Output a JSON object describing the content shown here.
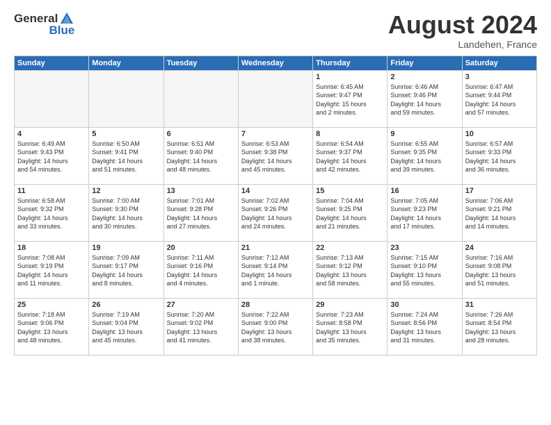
{
  "header": {
    "logo_general": "General",
    "logo_blue": "Blue",
    "month_year": "August 2024",
    "location": "Landehen, France"
  },
  "weekdays": [
    "Sunday",
    "Monday",
    "Tuesday",
    "Wednesday",
    "Thursday",
    "Friday",
    "Saturday"
  ],
  "weeks": [
    [
      {
        "day": "",
        "info": ""
      },
      {
        "day": "",
        "info": ""
      },
      {
        "day": "",
        "info": ""
      },
      {
        "day": "",
        "info": ""
      },
      {
        "day": "1",
        "info": "Sunrise: 6:45 AM\nSunset: 9:47 PM\nDaylight: 15 hours\nand 2 minutes."
      },
      {
        "day": "2",
        "info": "Sunrise: 6:46 AM\nSunset: 9:46 PM\nDaylight: 14 hours\nand 59 minutes."
      },
      {
        "day": "3",
        "info": "Sunrise: 6:47 AM\nSunset: 9:44 PM\nDaylight: 14 hours\nand 57 minutes."
      }
    ],
    [
      {
        "day": "4",
        "info": "Sunrise: 6:49 AM\nSunset: 9:43 PM\nDaylight: 14 hours\nand 54 minutes."
      },
      {
        "day": "5",
        "info": "Sunrise: 6:50 AM\nSunset: 9:41 PM\nDaylight: 14 hours\nand 51 minutes."
      },
      {
        "day": "6",
        "info": "Sunrise: 6:51 AM\nSunset: 9:40 PM\nDaylight: 14 hours\nand 48 minutes."
      },
      {
        "day": "7",
        "info": "Sunrise: 6:53 AM\nSunset: 9:38 PM\nDaylight: 14 hours\nand 45 minutes."
      },
      {
        "day": "8",
        "info": "Sunrise: 6:54 AM\nSunset: 9:37 PM\nDaylight: 14 hours\nand 42 minutes."
      },
      {
        "day": "9",
        "info": "Sunrise: 6:55 AM\nSunset: 9:35 PM\nDaylight: 14 hours\nand 39 minutes."
      },
      {
        "day": "10",
        "info": "Sunrise: 6:57 AM\nSunset: 9:33 PM\nDaylight: 14 hours\nand 36 minutes."
      }
    ],
    [
      {
        "day": "11",
        "info": "Sunrise: 6:58 AM\nSunset: 9:32 PM\nDaylight: 14 hours\nand 33 minutes."
      },
      {
        "day": "12",
        "info": "Sunrise: 7:00 AM\nSunset: 9:30 PM\nDaylight: 14 hours\nand 30 minutes."
      },
      {
        "day": "13",
        "info": "Sunrise: 7:01 AM\nSunset: 9:28 PM\nDaylight: 14 hours\nand 27 minutes."
      },
      {
        "day": "14",
        "info": "Sunrise: 7:02 AM\nSunset: 9:26 PM\nDaylight: 14 hours\nand 24 minutes."
      },
      {
        "day": "15",
        "info": "Sunrise: 7:04 AM\nSunset: 9:25 PM\nDaylight: 14 hours\nand 21 minutes."
      },
      {
        "day": "16",
        "info": "Sunrise: 7:05 AM\nSunset: 9:23 PM\nDaylight: 14 hours\nand 17 minutes."
      },
      {
        "day": "17",
        "info": "Sunrise: 7:06 AM\nSunset: 9:21 PM\nDaylight: 14 hours\nand 14 minutes."
      }
    ],
    [
      {
        "day": "18",
        "info": "Sunrise: 7:08 AM\nSunset: 9:19 PM\nDaylight: 14 hours\nand 11 minutes."
      },
      {
        "day": "19",
        "info": "Sunrise: 7:09 AM\nSunset: 9:17 PM\nDaylight: 14 hours\nand 8 minutes."
      },
      {
        "day": "20",
        "info": "Sunrise: 7:11 AM\nSunset: 9:16 PM\nDaylight: 14 hours\nand 4 minutes."
      },
      {
        "day": "21",
        "info": "Sunrise: 7:12 AM\nSunset: 9:14 PM\nDaylight: 14 hours\nand 1 minute."
      },
      {
        "day": "22",
        "info": "Sunrise: 7:13 AM\nSunset: 9:12 PM\nDaylight: 13 hours\nand 58 minutes."
      },
      {
        "day": "23",
        "info": "Sunrise: 7:15 AM\nSunset: 9:10 PM\nDaylight: 13 hours\nand 55 minutes."
      },
      {
        "day": "24",
        "info": "Sunrise: 7:16 AM\nSunset: 9:08 PM\nDaylight: 13 hours\nand 51 minutes."
      }
    ],
    [
      {
        "day": "25",
        "info": "Sunrise: 7:18 AM\nSunset: 9:06 PM\nDaylight: 13 hours\nand 48 minutes."
      },
      {
        "day": "26",
        "info": "Sunrise: 7:19 AM\nSunset: 9:04 PM\nDaylight: 13 hours\nand 45 minutes."
      },
      {
        "day": "27",
        "info": "Sunrise: 7:20 AM\nSunset: 9:02 PM\nDaylight: 13 hours\nand 41 minutes."
      },
      {
        "day": "28",
        "info": "Sunrise: 7:22 AM\nSunset: 9:00 PM\nDaylight: 13 hours\nand 38 minutes."
      },
      {
        "day": "29",
        "info": "Sunrise: 7:23 AM\nSunset: 8:58 PM\nDaylight: 13 hours\nand 35 minutes."
      },
      {
        "day": "30",
        "info": "Sunrise: 7:24 AM\nSunset: 8:56 PM\nDaylight: 13 hours\nand 31 minutes."
      },
      {
        "day": "31",
        "info": "Sunrise: 7:26 AM\nSunset: 8:54 PM\nDaylight: 13 hours\nand 28 minutes."
      }
    ]
  ]
}
